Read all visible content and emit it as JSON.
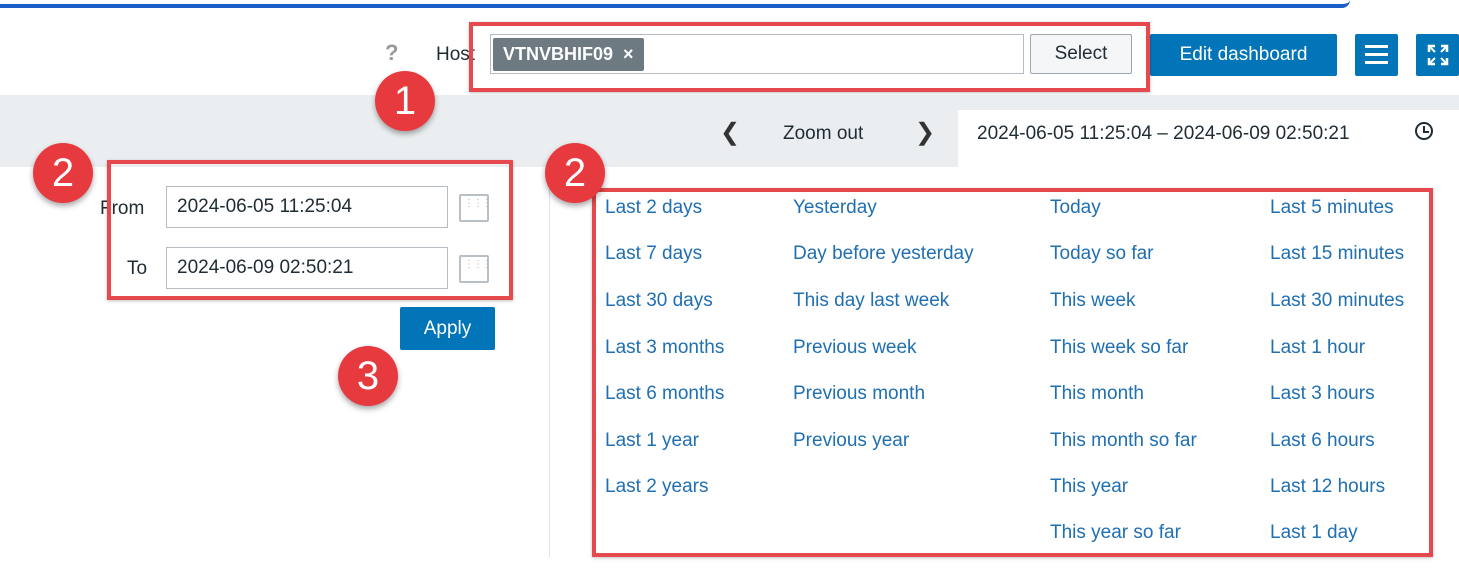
{
  "header": {
    "help_glyph": "?",
    "host_label": "Host",
    "host_chip": "VTNVBHIF09",
    "chip_remove_glyph": "×",
    "select_label": "Select",
    "edit_dashboard_label": "Edit dashboard"
  },
  "time_nav": {
    "prev_glyph": "❮",
    "zoom_out_label": "Zoom out",
    "next_glyph": "❯",
    "range_text": "2024-06-05 11:25:04 – 2024-06-09 02:50:21"
  },
  "range_form": {
    "from_label": "From",
    "from_value": "2024-06-05 11:25:04",
    "to_label": "To",
    "to_value": "2024-06-09 02:50:21",
    "apply_label": "Apply"
  },
  "quick_ranges": {
    "col1": [
      "Last 2 days",
      "Last 7 days",
      "Last 30 days",
      "Last 3 months",
      "Last 6 months",
      "Last 1 year",
      "Last 2 years"
    ],
    "col2": [
      "Yesterday",
      "Day before yesterday",
      "This day last week",
      "Previous week",
      "Previous month",
      "Previous year"
    ],
    "col3": [
      "Today",
      "Today so far",
      "This week",
      "This week so far",
      "This month",
      "This month so far",
      "This year",
      "This year so far"
    ],
    "col4": [
      "Last 5 minutes",
      "Last 15 minutes",
      "Last 30 minutes",
      "Last 1 hour",
      "Last 3 hours",
      "Last 6 hours",
      "Last 12 hours",
      "Last 1 day"
    ]
  },
  "annotations": {
    "badge_1": "1",
    "badge_2a": "2",
    "badge_2b": "2",
    "badge_3": "3"
  },
  "colors": {
    "accent_blue": "#0275b8",
    "link_blue": "#1f6fb2",
    "annotation_red": "#e5484d",
    "chip_gray": "#6e7a82"
  },
  "icons": [
    "help-icon",
    "remove-icon",
    "hamburger-menu-icon",
    "fullscreen-icon",
    "chevron-left-icon",
    "chevron-right-icon",
    "clock-icon",
    "calendar-icon"
  ]
}
